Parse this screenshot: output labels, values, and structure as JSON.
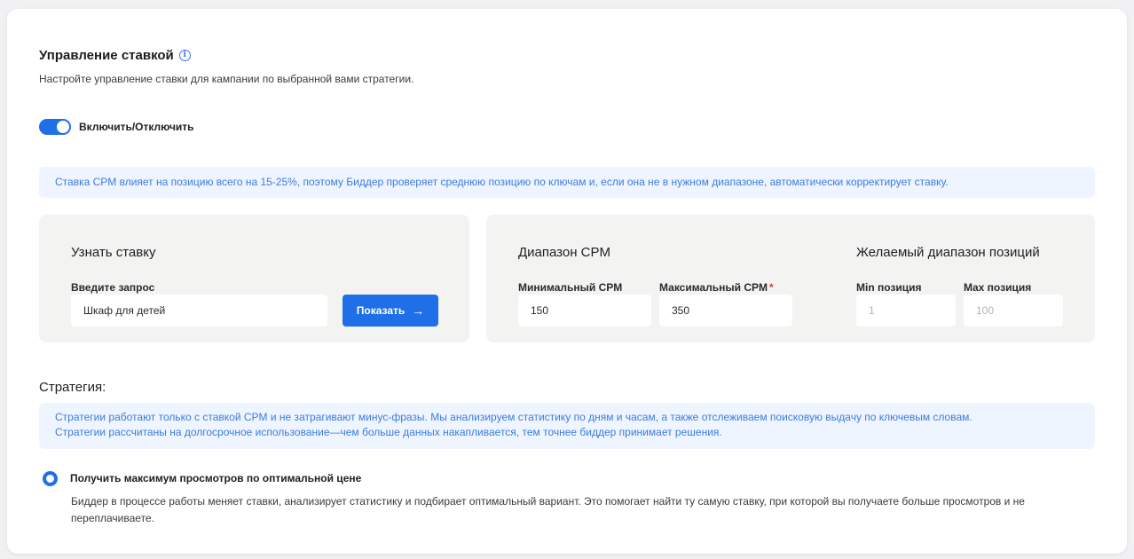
{
  "header": {
    "title": "Управление ставкой",
    "info_icon": "i",
    "subtitle": "Настройте управление ставки для кампании по выбранной вами стратегии."
  },
  "toggle": {
    "label": "Включить/Отключить",
    "state": "on",
    "color": "#1f6fe8"
  },
  "info_cpm": "Ставка CPM влияет на позицию всего на 15-25%, поэтому Биддер проверяет среднюю позицию по ключам и, если она не в нужном диапазоне, автоматически корректирует ставку.",
  "know_bid": {
    "title": "Узнать ставку",
    "query_label": "Введите запрос",
    "query_value": "Шкаф для детей",
    "button_label": "Показать",
    "button_icon": "arrow-right-icon"
  },
  "cpm_range": {
    "title": "Диапазон CPM",
    "min_label": "Минимальный CPM",
    "min_value": "150",
    "max_label": "Максимальный CPM",
    "max_required": "*",
    "max_value": "350"
  },
  "positions": {
    "title": "Желаемый диапазон позиций",
    "min_label": "Min позиция",
    "min_placeholder": "1",
    "max_label": "Max позиция",
    "max_placeholder": "100"
  },
  "strategy": {
    "title": "Стратегия:",
    "info_line1": "Стратегии работают только с ставкой CPM и не затрагивают минус-фразы. Мы анализируем статистику по дням и часам, а также отслеживаем поисковую выдачу по ключевым словам.",
    "info_line2": "Стратегии рассчитаны на долгосрочное использование—чем больше данных накапливается, тем точнее биддер принимает решения.",
    "option_title": "Получить максимум просмотров по оптимальной цене",
    "option_desc": "Биддер в процессе работы меняет ставки, анализирует статистику и подбирает оптимальный вариант. Это помогает найти ту самую ставку, при которой вы получаете больше просмотров и не переплачиваете.",
    "option_selected": true
  }
}
